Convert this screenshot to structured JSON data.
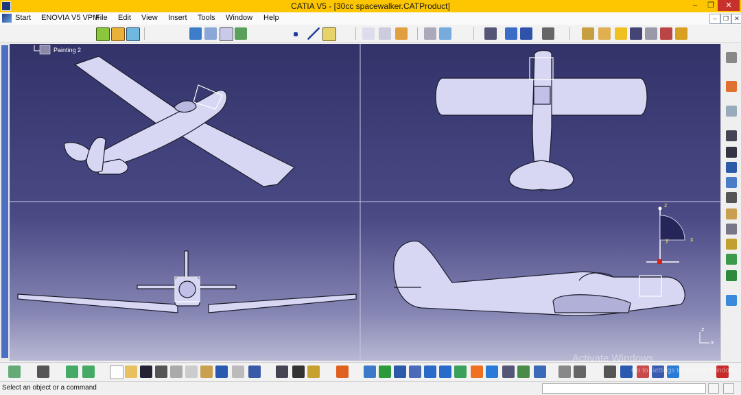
{
  "window": {
    "title": "CATIA V5 - [30cc spacewalker.CATProduct]",
    "controls": {
      "minimize": "–",
      "restore": "❐",
      "close": "✕"
    }
  },
  "menu": {
    "items": [
      "Start",
      "ENOVIA V5 VPM",
      "File",
      "Edit",
      "View",
      "Insert",
      "Tools",
      "Window",
      "Help"
    ]
  },
  "tree": {
    "node_label": "Painting 2"
  },
  "compass": {
    "z": "z",
    "y": "y",
    "x": "x"
  },
  "mini_axis": {
    "z": "z",
    "x": "x"
  },
  "status": {
    "message": "Select an object or a command"
  },
  "overlay": {
    "activate": "Activate Windows",
    "hint": "Go to Settings to activate Windows."
  },
  "colors": {
    "title_bar": "#fdc600",
    "viewport_top": "#33336a",
    "viewport_bottom": "#b9b9d4",
    "close_button": "#c7312b",
    "part_fill": "#d7d7f4"
  }
}
